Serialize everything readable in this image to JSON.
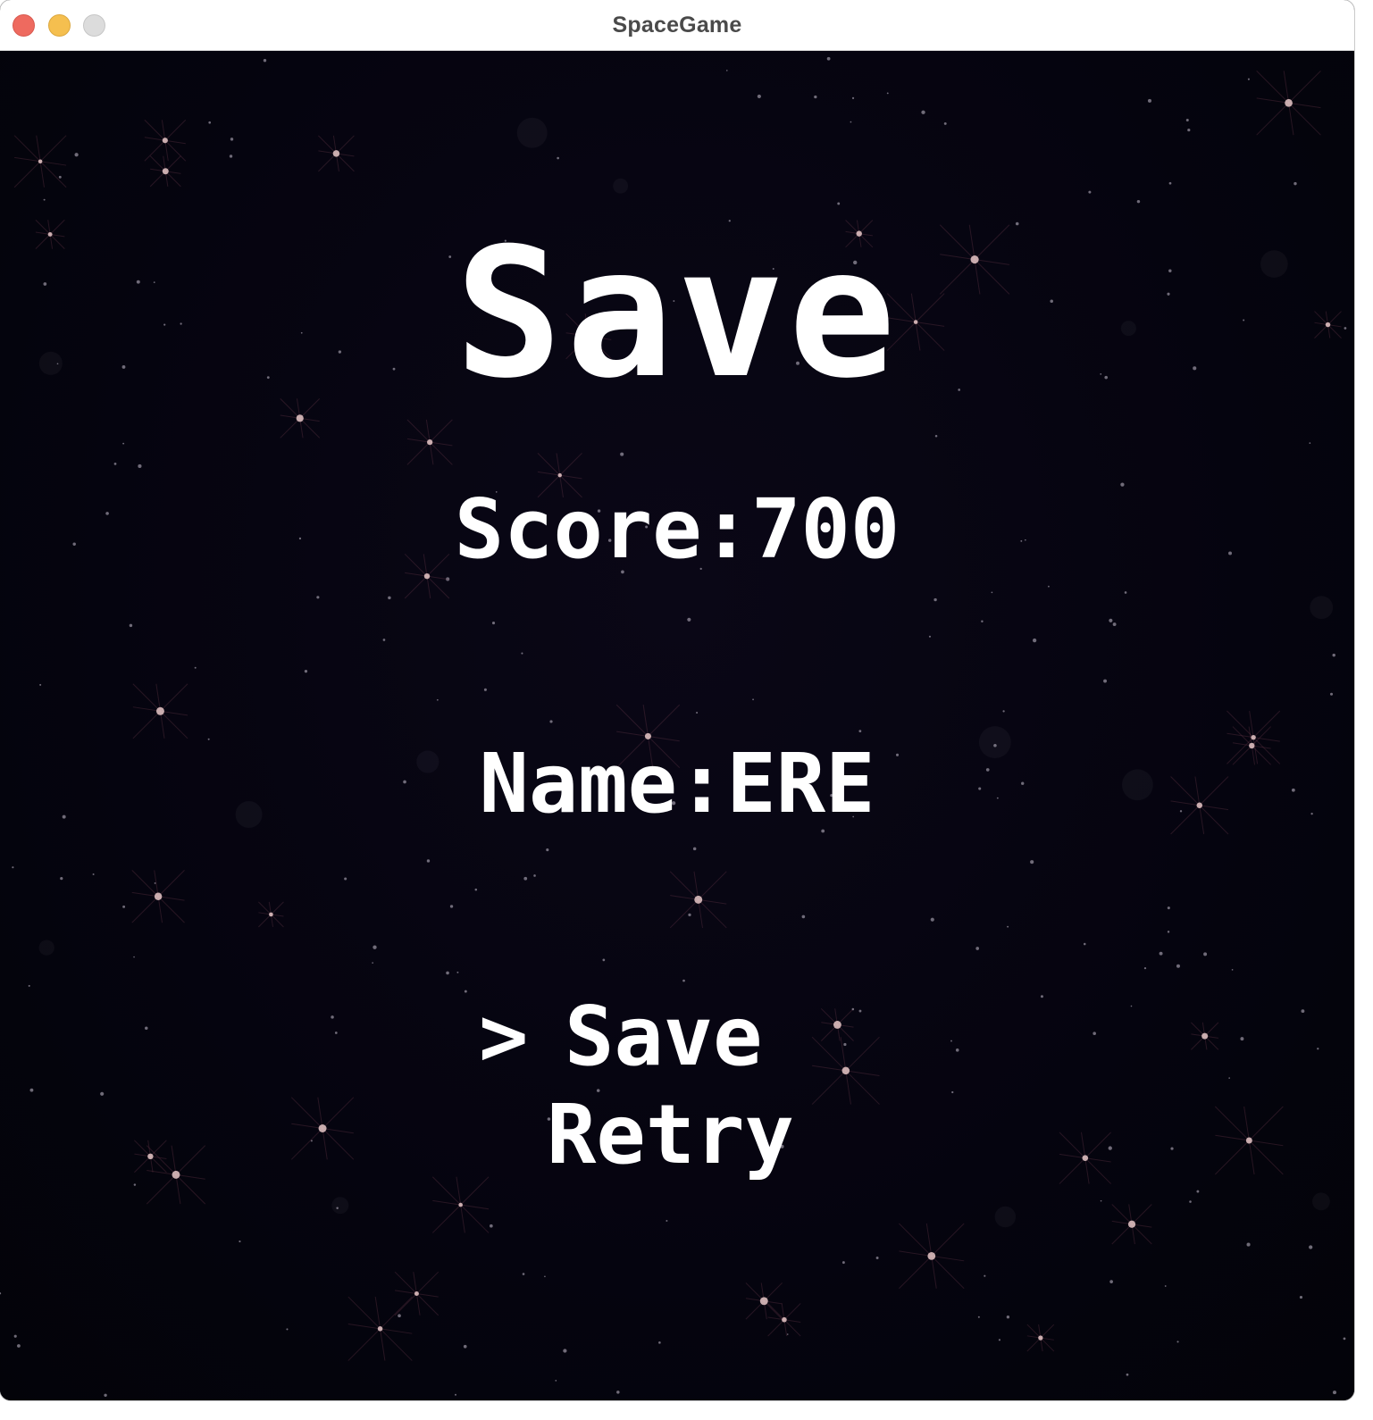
{
  "window": {
    "title": "SpaceGame",
    "colors": {
      "close": "#ee6a5f",
      "minimize": "#f5bf4f",
      "maximize": "#dcdcdc",
      "background": "#05040f",
      "text": "#ffffff"
    }
  },
  "screen": {
    "heading": "Save",
    "score_label": "Score:",
    "score_value": "700",
    "name_label": "Name:",
    "name_value": "ERE",
    "cursor": ">",
    "menu": [
      {
        "label": "Save",
        "selected": true
      },
      {
        "label": "Retry",
        "selected": false
      }
    ]
  }
}
